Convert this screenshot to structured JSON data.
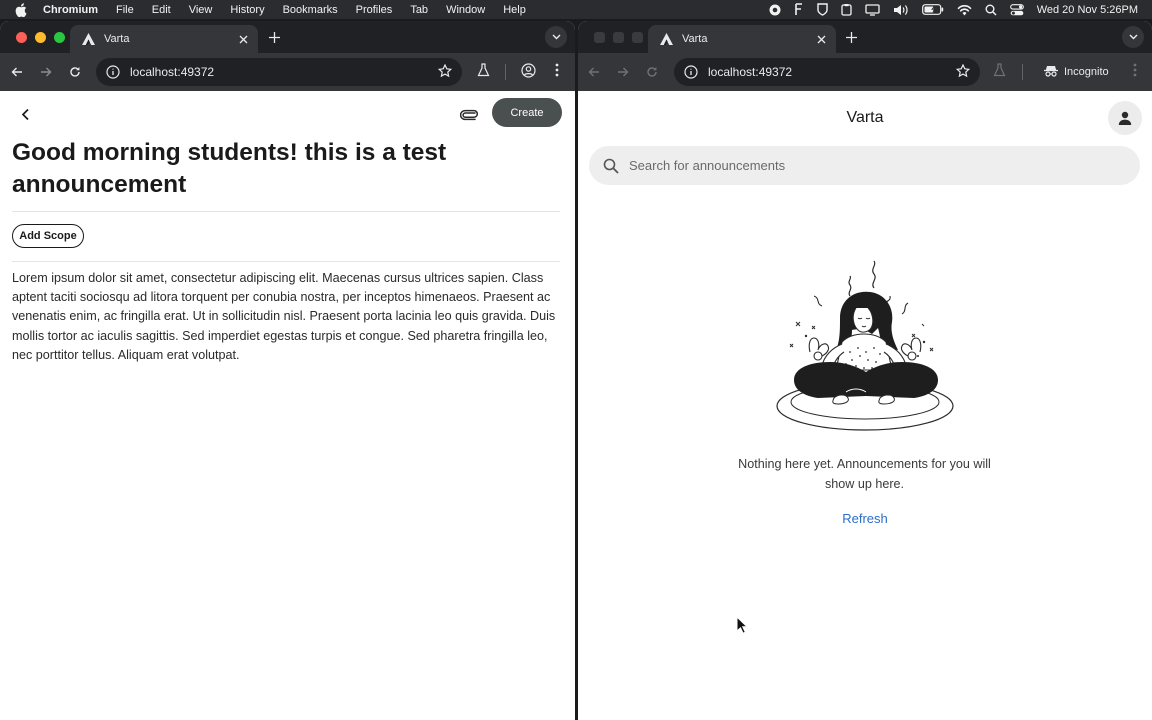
{
  "menubar": {
    "app_name": "Chromium",
    "items": [
      "File",
      "Edit",
      "View",
      "History",
      "Bookmarks",
      "Profiles",
      "Tab",
      "Window",
      "Help"
    ],
    "clock": "Wed 20 Nov  5:26PM"
  },
  "left_window": {
    "tab_title": "Varta",
    "url": "localhost:49372",
    "page": {
      "create_label": "Create",
      "title": "Good morning students! this is a test announcement",
      "add_scope_label": "Add Scope",
      "body": "Lorem ipsum dolor sit amet, consectetur adipiscing elit. Maecenas cursus ultrices sapien. Class aptent taciti sociosqu ad litora torquent per conubia nostra, per inceptos himenaeos. Praesent ac venenatis enim, ac fringilla erat. Ut in sollicitudin nisl. Praesent porta lacinia leo quis gravida. Duis mollis tortor ac iaculis sagittis. Sed imperdiet egestas turpis et congue. Sed pharetra fringilla leo, nec porttitor tellus. Aliquam erat volutpat."
    }
  },
  "right_window": {
    "tab_title": "Varta",
    "url": "localhost:49372",
    "incognito_label": "Incognito",
    "page": {
      "app_title": "Varta",
      "search_placeholder": "Search for announcements",
      "empty_message": "Nothing here yet. Announcements for you will show up here.",
      "refresh_label": "Refresh"
    }
  },
  "colors": {
    "create_button": "#4a4f4f",
    "link": "#2b6fc9",
    "chrome_toolbar": "#35363a"
  }
}
